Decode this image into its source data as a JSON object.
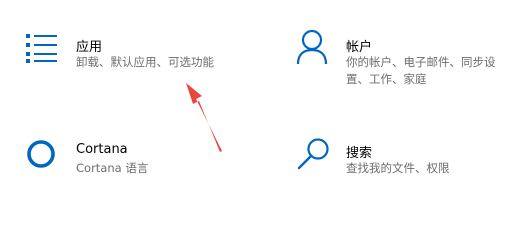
{
  "tiles": [
    {
      "title": "应用",
      "desc_lines": [
        "卸载、默认应用、可选功能"
      ],
      "icon": "apps-list-icon"
    },
    {
      "title": "帐户",
      "desc_lines": [
        "你的帐户、电子邮件、同步设",
        "置、工作、家庭"
      ],
      "icon": "person-icon"
    },
    {
      "title": "Cortana",
      "desc_lines": [
        "Cortana 语言"
      ],
      "icon": "cortana-circle-icon"
    },
    {
      "title": "搜索",
      "desc_lines": [
        "查找我的文件、权限"
      ],
      "icon": "search-icon"
    }
  ],
  "colors": {
    "accent": "#0067c0",
    "annotation": "#e8473b",
    "secondary_text": "#6e6e6e"
  }
}
